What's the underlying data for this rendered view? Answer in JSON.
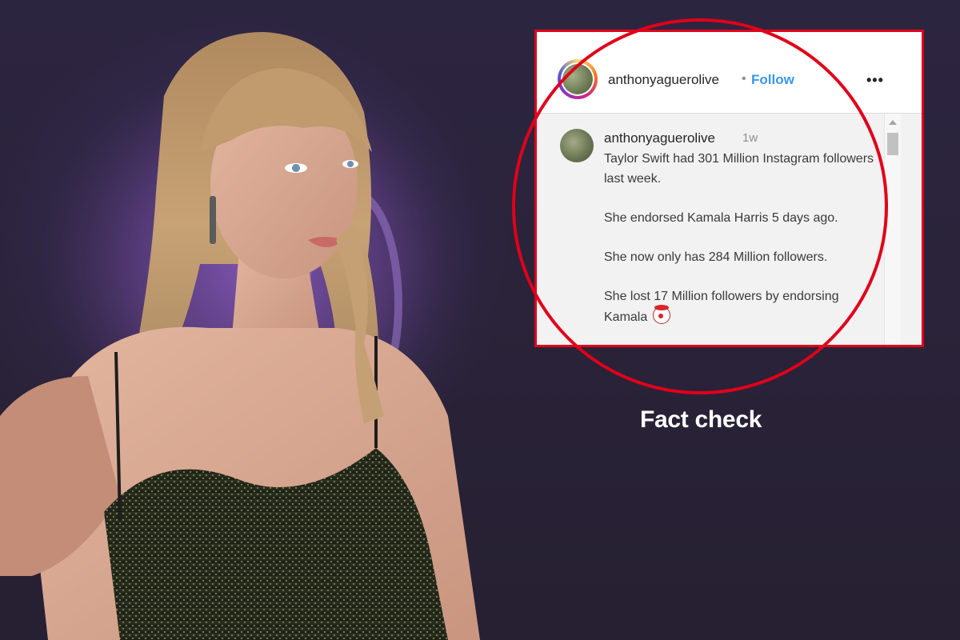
{
  "colors": {
    "background": "#2a2438",
    "frame_border": "#e0001a",
    "circle_stroke": "#e0001a",
    "follow_link": "#3897f0",
    "comment_background": "#f2f2f2"
  },
  "post": {
    "header": {
      "username": "anthonyaguerolive",
      "separator": "•",
      "follow_label": "Follow",
      "more_label": "•••",
      "avatar_icon": "profile-avatar",
      "more_icon": "more-options-icon"
    },
    "comment": {
      "username": "anthonyaguerolive",
      "time": "1w",
      "paragraphs": [
        "Taylor Swift had 301 Million Instagram followers last week.",
        "She endorsed Kamala Harris 5 days ago.",
        "She now only has 284 Million followers.",
        "She lost 17 Million followers by endorsing Kamala"
      ],
      "trailing_emoji": "clown-face-emoji"
    },
    "scrollbar_position": 0.0
  },
  "caption": {
    "label": "Fact check"
  }
}
